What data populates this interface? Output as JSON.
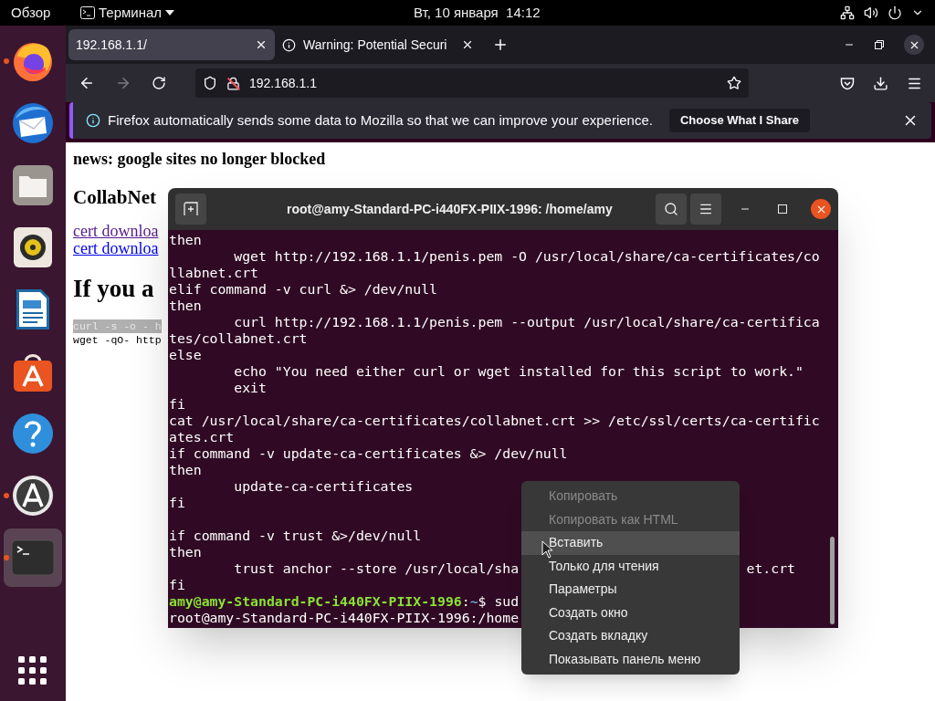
{
  "top_bar": {
    "activities": "Обзор",
    "app_menu": "Терминал",
    "clock": "Вт, 10 января  14:12"
  },
  "dock": {
    "items": [
      {
        "kind": "firefox",
        "running": true,
        "selected": false
      },
      {
        "kind": "mail",
        "running": false,
        "selected": false
      },
      {
        "kind": "files",
        "running": false,
        "selected": false
      },
      {
        "kind": "music",
        "running": false,
        "selected": false
      },
      {
        "kind": "writer",
        "running": false,
        "selected": false
      },
      {
        "kind": "software",
        "running": false,
        "selected": false
      },
      {
        "kind": "help",
        "running": false,
        "selected": false
      },
      {
        "kind": "updater",
        "running": true,
        "selected": false
      },
      {
        "kind": "terminal",
        "running": true,
        "selected": true
      }
    ]
  },
  "browser": {
    "tabs": [
      {
        "title": "192.168.1.1/",
        "selected": true
      },
      {
        "title": "Warning: Potential Securi",
        "selected": false
      }
    ],
    "url": "192.168.1.1",
    "notification": {
      "message": "Firefox automatically sends some data to Mozilla so that we can improve your experience.",
      "button": "Choose What I Share"
    },
    "page": {
      "news": "news: google sites no longer blocked",
      "heading": "CollabNet",
      "links": [
        {
          "text": "cert downloa",
          "visited": true
        },
        {
          "text": "cert downloa",
          "visited": false
        }
      ],
      "big_heading": "If you a",
      "code_lines": [
        {
          "text": "curl -s -o - h",
          "highlighted": true
        },
        {
          "text": "wget -qO- http",
          "highlighted": false
        }
      ]
    }
  },
  "terminal": {
    "title": "root@amy-Standard-PC-i440FX-PIIX-1996: /home/amy",
    "lines": [
      {
        "kind": "text",
        "text": "then"
      },
      {
        "kind": "text",
        "text": "        wget http://192.168.1.1/penis.pem -O /usr/local/share/ca-certificates/co"
      },
      {
        "kind": "text",
        "text": "llabnet.crt"
      },
      {
        "kind": "text",
        "text": "elif command -v curl &> /dev/null"
      },
      {
        "kind": "text",
        "text": "then"
      },
      {
        "kind": "text",
        "text": "        curl http://192.168.1.1/penis.pem --output /usr/local/share/ca-certifica"
      },
      {
        "kind": "text",
        "text": "tes/collabnet.crt"
      },
      {
        "kind": "text",
        "text": "else"
      },
      {
        "kind": "text",
        "text": "        echo \"You need either curl or wget installed for this script to work.\""
      },
      {
        "kind": "text",
        "text": "        exit"
      },
      {
        "kind": "text",
        "text": "fi"
      },
      {
        "kind": "text",
        "text": "cat /usr/local/share/ca-certificates/collabnet.crt >> /etc/ssl/certs/ca-certific"
      },
      {
        "kind": "text",
        "text": "ates.crt"
      },
      {
        "kind": "text",
        "text": "if command -v update-ca-certificates &> /dev/null"
      },
      {
        "kind": "text",
        "text": "then"
      },
      {
        "kind": "text",
        "text": "        update-ca-certificates"
      },
      {
        "kind": "text",
        "text": "fi"
      },
      {
        "kind": "blank"
      },
      {
        "kind": "text",
        "text": "if command -v trust &>/dev/null"
      },
      {
        "kind": "text",
        "text": "then"
      },
      {
        "kind": "split",
        "text": "        trust anchor --store /usr/local/sha",
        "tail": "et.crt"
      },
      {
        "kind": "text",
        "text": "fi"
      },
      {
        "kind": "prompt",
        "user_host": "amy@amy-Standard-PC-i440FX-PIIX-1996",
        "sep": ":",
        "path": "~",
        "command": "$ sud"
      },
      {
        "kind": "text",
        "text": "root@amy-Standard-PC-i440FX-PIIX-1996:/home"
      }
    ]
  },
  "context_menu": {
    "items": [
      {
        "label": "Копировать",
        "disabled": true,
        "selected": false
      },
      {
        "label": "Копировать как HTML",
        "disabled": true,
        "selected": false
      },
      {
        "label": "Вставить",
        "disabled": false,
        "selected": true
      },
      {
        "label": "Только для чтения",
        "disabled": false,
        "selected": false
      },
      {
        "label": "Параметры",
        "disabled": false,
        "selected": false
      },
      {
        "label": "Создать окно",
        "disabled": false,
        "selected": false
      },
      {
        "label": "Создать вкладку",
        "disabled": false,
        "selected": false
      },
      {
        "label": "Показывать панель меню",
        "disabled": false,
        "selected": false
      }
    ]
  }
}
